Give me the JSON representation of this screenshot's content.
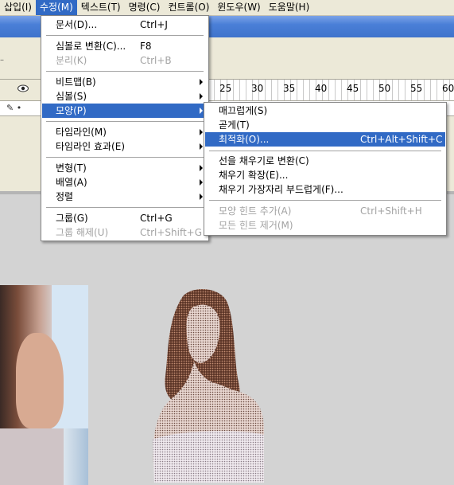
{
  "menubar": {
    "items": [
      "삽입(I)",
      "수정(M)",
      "텍스트(T)",
      "명령(C)",
      "컨트롤(O)",
      "윈도우(W)",
      "도움말(H)"
    ]
  },
  "timeline": {
    "ruler": [
      "25",
      "30",
      "35",
      "40",
      "45",
      "50",
      "55",
      "60"
    ]
  },
  "modify_menu": {
    "items": [
      {
        "label": "문서(D)...",
        "shortcut": "Ctrl+J"
      },
      {
        "label": "심볼로 변환(C)...",
        "shortcut": "F8"
      },
      {
        "label": "분리(K)",
        "shortcut": "Ctrl+B",
        "disabled": true
      },
      {
        "label": "비트맵(B)",
        "submenu": true
      },
      {
        "label": "심볼(S)",
        "submenu": true
      },
      {
        "label": "모양(P)",
        "submenu": true,
        "highlighted": true
      },
      {
        "label": "타임라인(M)",
        "submenu": true
      },
      {
        "label": "타임라인 효과(E)",
        "submenu": true
      },
      {
        "label": "변형(T)",
        "submenu": true
      },
      {
        "label": "배열(A)",
        "submenu": true
      },
      {
        "label": "정렬",
        "submenu": true
      },
      {
        "label": "그룹(G)",
        "shortcut": "Ctrl+G"
      },
      {
        "label": "그룹 해제(U)",
        "shortcut": "Ctrl+Shift+G",
        "disabled": true
      }
    ]
  },
  "shape_submenu": {
    "items": [
      {
        "label": "매끄럽게(S)"
      },
      {
        "label": "곧게(T)"
      },
      {
        "label": "최적화(O)...",
        "shortcut": "Ctrl+Alt+Shift+C",
        "highlighted": true
      },
      {
        "label": "선을 채우기로 변환(C)"
      },
      {
        "label": "채우기 확장(E)..."
      },
      {
        "label": "채우기 가장자리 부드럽게(F)..."
      },
      {
        "label": "모양 힌트 추가(A)",
        "shortcut": "Ctrl+Shift+H",
        "disabled": true
      },
      {
        "label": "모든 힌트 제거(M)",
        "disabled": true
      }
    ]
  },
  "colors": {
    "highlight": "#316ac5",
    "menubar": "#ece9d8",
    "stage": "#d3d3d3"
  }
}
